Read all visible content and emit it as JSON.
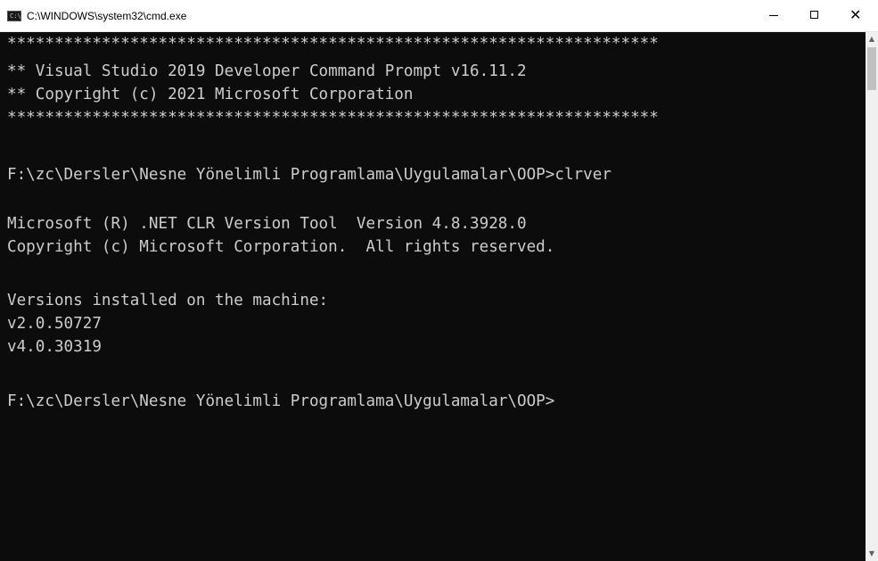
{
  "window": {
    "title": "C:\\WINDOWS\\system32\\cmd.exe",
    "icon": "cmd-console-icon",
    "icon_glyph": "C:\\",
    "controls": {
      "minimize": "minimize-icon",
      "maximize": "maximize-icon",
      "close": "close-icon",
      "close_glyph": "✕"
    }
  },
  "console": {
    "background": "#0c0c0c",
    "foreground": "#cccccc",
    "lines": [
      "*********************************************************************",
      "** Visual Studio 2019 Developer Command Prompt v16.11.2",
      "** Copyright (c) 2021 Microsoft Corporation",
      "*********************************************************************",
      "",
      "F:\\zc\\Dersler\\Nesne Yönelimli Programlama\\Uygulamalar\\OOP>clrver",
      "",
      "Microsoft (R) .NET CLR Version Tool  Version 4.8.3928.0",
      "Copyright (c) Microsoft Corporation.  All rights reserved.",
      "",
      "Versions installed on the machine:",
      "v2.0.50727",
      "v4.0.30319",
      "",
      "F:\\zc\\Dersler\\Nesne Yönelimli Programlama\\Uygulamalar\\OOP>"
    ]
  },
  "scrollbar": {
    "up_arrow": "▲",
    "down_arrow": "▼"
  }
}
